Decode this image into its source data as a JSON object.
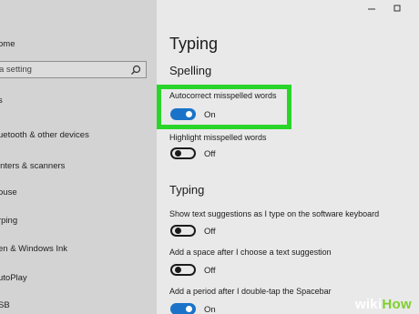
{
  "sidebar": {
    "home_label": "ome",
    "search_placeholder": "a setting",
    "section_label": "s",
    "items": [
      {
        "label": "uetooth & other devices"
      },
      {
        "label": "inters & scanners"
      },
      {
        "label": "ouse"
      },
      {
        "label": "rping"
      },
      {
        "label": "en & Windows Ink"
      },
      {
        "label": "utoPlay"
      },
      {
        "label": "SB"
      }
    ]
  },
  "page": {
    "title": "Typing",
    "spelling_header": "Spelling",
    "typing_header": "Typing",
    "settings": [
      {
        "label": "Autocorrect misspelled words",
        "state": "On",
        "on": true
      },
      {
        "label": "Highlight misspelled words",
        "state": "Off",
        "on": false
      },
      {
        "label": "Show text suggestions as I type on the software keyboard",
        "state": "Off",
        "on": false
      },
      {
        "label": "Add a space after I choose a text suggestion",
        "state": "Off",
        "on": false
      },
      {
        "label": "Add a period after I double-tap the Spacebar",
        "state": "On",
        "on": true
      }
    ]
  },
  "watermark": {
    "wiki": "wiki",
    "how": "How"
  },
  "colors": {
    "accent": "#1a73c9",
    "highlight": "#2ad52a",
    "sidebar_bg": "#d3d3d3",
    "main_bg": "#e9e9e9"
  }
}
